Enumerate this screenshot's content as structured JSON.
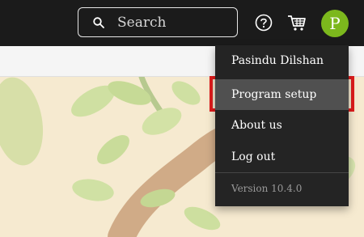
{
  "header": {
    "search_placeholder": "Search",
    "avatar_letter": "P",
    "avatar_color": "#7cb81d"
  },
  "icons": {
    "search": "search-icon",
    "help": "help-icon",
    "cart": "cart-icon",
    "chevron": "chevron-down-icon"
  },
  "user_menu": {
    "user_name": "Pasindu Dilshan",
    "items": [
      {
        "label": "Program setup"
      },
      {
        "label": "About us"
      },
      {
        "label": "Log out"
      }
    ],
    "version": "Version 10.4.0",
    "highlight_color": "#e21c1c"
  }
}
